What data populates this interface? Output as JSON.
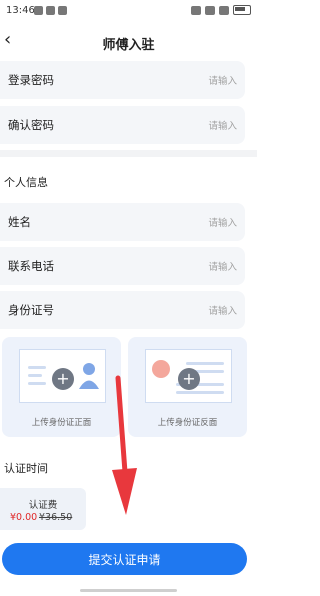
{
  "status_bar": {
    "time": "13:46"
  },
  "nav": {
    "title": "师傅入驻",
    "back_icon": "chevron-left-icon"
  },
  "account": {
    "login_password": {
      "label": "登录密码",
      "placeholder": "请输入"
    },
    "confirm_password": {
      "label": "确认密码",
      "placeholder": "请输入"
    }
  },
  "personal": {
    "title": "个人信息",
    "name": {
      "label": "姓名",
      "placeholder": "请输入"
    },
    "phone": {
      "label": "联系电话",
      "placeholder": "请输入"
    },
    "id_number": {
      "label": "身份证号",
      "placeholder": "请输入"
    }
  },
  "uploads": {
    "front_label": "上传身份证正面",
    "back_label": "上传身份证反面"
  },
  "certification": {
    "title": "认证时间",
    "fee_label": "认证费",
    "price": "¥0.00",
    "original_price": "¥36.50"
  },
  "submit_label": "提交认证申请",
  "colors": {
    "accent": "#1f78f0",
    "price": "#e02828",
    "arrow": "#e8383d"
  }
}
